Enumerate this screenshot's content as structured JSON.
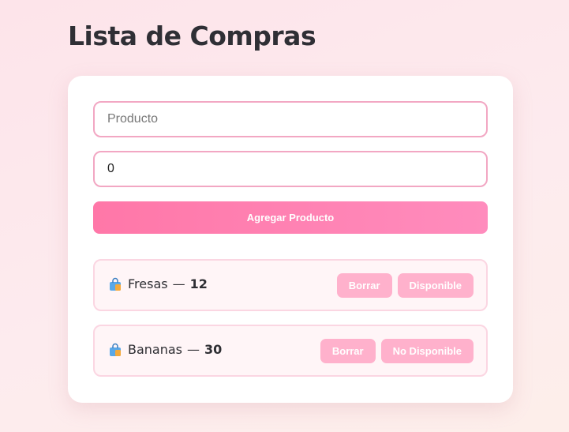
{
  "header": {
    "title": "Lista de Compras"
  },
  "form": {
    "product_placeholder": "Producto",
    "quantity_value": "0",
    "add_label": "Agregar Producto"
  },
  "items": [
    {
      "name": "Fresas",
      "separator": "—",
      "quantity": "12",
      "delete_label": "Borrar",
      "status_label": "Disponible"
    },
    {
      "name": "Bananas",
      "separator": "—",
      "quantity": "30",
      "delete_label": "Borrar",
      "status_label": "No Disponible"
    }
  ],
  "icons": {
    "item_icon": "shopping-bag-icon"
  },
  "colors": {
    "accent": "#ff77a8",
    "border": "#f2a7c3",
    "pill": "#ffb1cc",
    "item_bg": "#fff5f7"
  }
}
